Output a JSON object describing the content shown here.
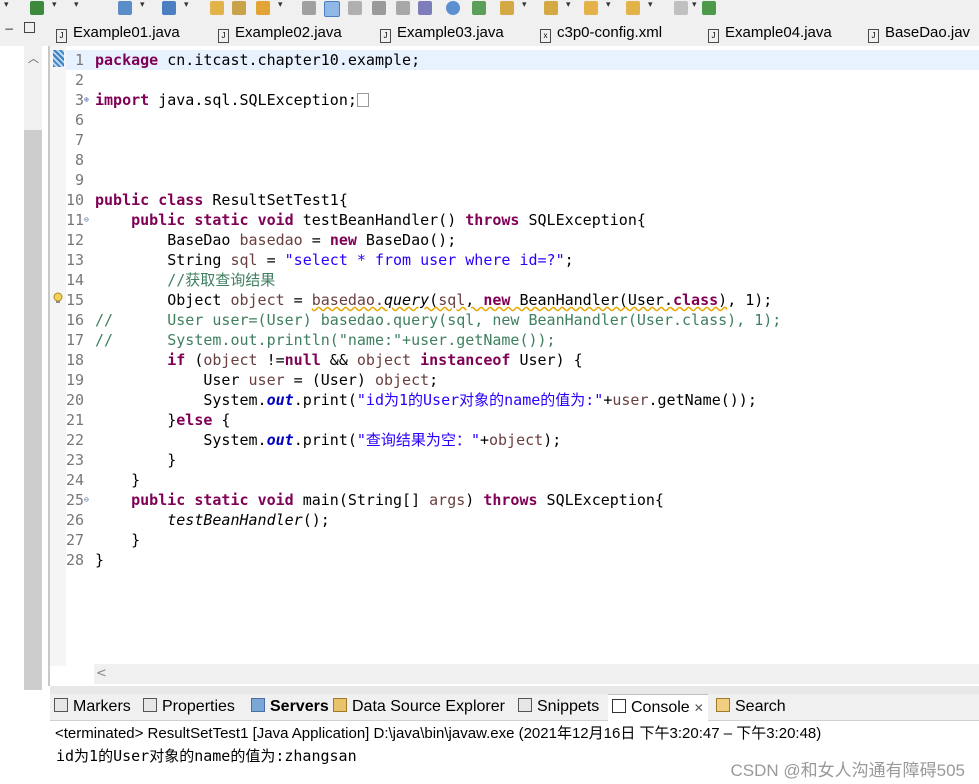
{
  "editor_tabs": [
    {
      "label": "Example01.java",
      "icon": "java-file-icon"
    },
    {
      "label": "Example02.java",
      "icon": "java-file-icon"
    },
    {
      "label": "Example03.java",
      "icon": "java-file-icon"
    },
    {
      "label": "c3p0-config.xml",
      "icon": "xml-file-icon"
    },
    {
      "label": "Example04.java",
      "icon": "java-file-icon"
    },
    {
      "label": "BaseDao.jav",
      "icon": "java-file-icon"
    }
  ],
  "code": {
    "lines": [
      {
        "n": "1",
        "fold": "",
        "tokens": [
          {
            "k": "kw",
            "t": "package"
          },
          {
            "k": "t",
            "t": " cn.itcast.chapter10.example;"
          }
        ]
      },
      {
        "n": "2",
        "fold": "",
        "tokens": []
      },
      {
        "n": "3",
        "fold": "⊕",
        "tokens": [
          {
            "k": "kw",
            "t": "import"
          },
          {
            "k": "t",
            "t": " java.sql.SQLException;"
          }
        ],
        "collapsed": true
      },
      {
        "n": "6",
        "fold": "",
        "tokens": []
      },
      {
        "n": "7",
        "fold": "",
        "tokens": []
      },
      {
        "n": "8",
        "fold": "",
        "tokens": []
      },
      {
        "n": "9",
        "fold": "",
        "tokens": []
      },
      {
        "n": "10",
        "fold": "",
        "tokens": [
          {
            "k": "kw",
            "t": "public"
          },
          {
            "k": "t",
            "t": " "
          },
          {
            "k": "kw",
            "t": "class"
          },
          {
            "k": "t",
            "t": " ResultSetTest1{"
          }
        ]
      },
      {
        "n": "11",
        "fold": "⊖",
        "tokens": [
          {
            "k": "t",
            "t": "    "
          },
          {
            "k": "kw",
            "t": "public"
          },
          {
            "k": "t",
            "t": " "
          },
          {
            "k": "kw",
            "t": "static"
          },
          {
            "k": "t",
            "t": " "
          },
          {
            "k": "kw",
            "t": "void"
          },
          {
            "k": "t",
            "t": " testBeanHandler() "
          },
          {
            "k": "kw",
            "t": "throws"
          },
          {
            "k": "t",
            "t": " SQLException{"
          }
        ]
      },
      {
        "n": "12",
        "fold": "",
        "tokens": [
          {
            "k": "t",
            "t": "        BaseDao "
          },
          {
            "k": "var",
            "t": "basedao"
          },
          {
            "k": "t",
            "t": " = "
          },
          {
            "k": "kw",
            "t": "new"
          },
          {
            "k": "t",
            "t": " BaseDao();"
          }
        ]
      },
      {
        "n": "13",
        "fold": "",
        "tokens": [
          {
            "k": "t",
            "t": "        String "
          },
          {
            "k": "var",
            "t": "sql"
          },
          {
            "k": "t",
            "t": " = "
          },
          {
            "k": "str",
            "t": "\"select * from user where id=?\""
          },
          {
            "k": "t",
            "t": ";"
          }
        ]
      },
      {
        "n": "14",
        "fold": "",
        "tokens": [
          {
            "k": "t",
            "t": "        "
          },
          {
            "k": "cm",
            "t": "//获取查询结果"
          }
        ]
      },
      {
        "n": "15",
        "fold": "",
        "tokens": [
          {
            "k": "t",
            "t": "        Object "
          },
          {
            "k": "var",
            "t": "object"
          },
          {
            "k": "t",
            "t": " = "
          },
          {
            "k": "varw",
            "t": "basedao."
          },
          {
            "k": "italw",
            "t": "query"
          },
          {
            "k": "w",
            "t": "("
          },
          {
            "k": "varw",
            "t": "sql"
          },
          {
            "k": "w",
            "t": ", "
          },
          {
            "k": "kww",
            "t": "new"
          },
          {
            "k": "w",
            "t": " BeanHandler(User."
          },
          {
            "k": "kww",
            "t": "class"
          },
          {
            "k": "w",
            "t": ")"
          },
          {
            "k": "t",
            "t": ", 1);"
          }
        ]
      },
      {
        "n": "16",
        "fold": "",
        "tokens": [
          {
            "k": "cm",
            "t": "//      User user=(User) basedao.query(sql, new BeanHandler(User.class), 1);"
          }
        ]
      },
      {
        "n": "17",
        "fold": "",
        "tokens": [
          {
            "k": "cm",
            "t": "//      System.out.println(\"name:\"+user.getName());"
          }
        ]
      },
      {
        "n": "18",
        "fold": "",
        "tokens": [
          {
            "k": "t",
            "t": "        "
          },
          {
            "k": "kw",
            "t": "if"
          },
          {
            "k": "t",
            "t": " ("
          },
          {
            "k": "var",
            "t": "object"
          },
          {
            "k": "t",
            "t": " !="
          },
          {
            "k": "kw",
            "t": "null"
          },
          {
            "k": "t",
            "t": " && "
          },
          {
            "k": "var",
            "t": "object"
          },
          {
            "k": "t",
            "t": " "
          },
          {
            "k": "kw",
            "t": "instanceof"
          },
          {
            "k": "t",
            "t": " User) {"
          }
        ]
      },
      {
        "n": "19",
        "fold": "",
        "tokens": [
          {
            "k": "t",
            "t": "            User "
          },
          {
            "k": "var",
            "t": "user"
          },
          {
            "k": "t",
            "t": " = (User) "
          },
          {
            "k": "var",
            "t": "object"
          },
          {
            "k": "t",
            "t": ";"
          }
        ]
      },
      {
        "n": "20",
        "fold": "",
        "tokens": [
          {
            "k": "t",
            "t": "            System."
          },
          {
            "k": "fld",
            "t": "out"
          },
          {
            "k": "t",
            "t": ".print("
          },
          {
            "k": "str",
            "t": "\"id为1的User对象的name的值为:\""
          },
          {
            "k": "t",
            "t": "+"
          },
          {
            "k": "var",
            "t": "user"
          },
          {
            "k": "t",
            "t": ".getName());"
          }
        ]
      },
      {
        "n": "21",
        "fold": "",
        "tokens": [
          {
            "k": "t",
            "t": "        }"
          },
          {
            "k": "kw",
            "t": "else"
          },
          {
            "k": "t",
            "t": " {"
          }
        ]
      },
      {
        "n": "22",
        "fold": "",
        "tokens": [
          {
            "k": "t",
            "t": "            System."
          },
          {
            "k": "fld",
            "t": "out"
          },
          {
            "k": "t",
            "t": ".print("
          },
          {
            "k": "str",
            "t": "\"查询结果为空：\""
          },
          {
            "k": "t",
            "t": "+"
          },
          {
            "k": "var",
            "t": "object"
          },
          {
            "k": "t",
            "t": ");"
          }
        ]
      },
      {
        "n": "23",
        "fold": "",
        "tokens": [
          {
            "k": "t",
            "t": "        }"
          }
        ]
      },
      {
        "n": "24",
        "fold": "",
        "tokens": [
          {
            "k": "t",
            "t": "    }"
          }
        ]
      },
      {
        "n": "25",
        "fold": "⊖",
        "tokens": [
          {
            "k": "t",
            "t": "    "
          },
          {
            "k": "kw",
            "t": "public"
          },
          {
            "k": "t",
            "t": " "
          },
          {
            "k": "kw",
            "t": "static"
          },
          {
            "k": "t",
            "t": " "
          },
          {
            "k": "kw",
            "t": "void"
          },
          {
            "k": "t",
            "t": " main(String[] "
          },
          {
            "k": "var",
            "t": "args"
          },
          {
            "k": "t",
            "t": ") "
          },
          {
            "k": "kw",
            "t": "throws"
          },
          {
            "k": "t",
            "t": " SQLException{"
          }
        ]
      },
      {
        "n": "26",
        "fold": "",
        "tokens": [
          {
            "k": "t",
            "t": "        "
          },
          {
            "k": "ital",
            "t": "testBeanHandler"
          },
          {
            "k": "t",
            "t": "();"
          }
        ]
      },
      {
        "n": "27",
        "fold": "",
        "tokens": [
          {
            "k": "t",
            "t": "    }"
          }
        ]
      },
      {
        "n": "28",
        "fold": "",
        "tokens": [
          {
            "k": "t",
            "t": "}"
          }
        ]
      }
    ]
  },
  "bottom_tabs": [
    {
      "label": "Markers",
      "icon": "markers-icon",
      "active": false,
      "bold": false
    },
    {
      "label": "Properties",
      "icon": "properties-icon",
      "active": false,
      "bold": false
    },
    {
      "label": "Servers",
      "icon": "servers-icon",
      "active": false,
      "bold": true
    },
    {
      "label": "Data Source Explorer",
      "icon": "data-source-icon",
      "active": false,
      "bold": false
    },
    {
      "label": "Snippets",
      "icon": "snippets-icon",
      "active": false,
      "bold": false
    },
    {
      "label": "Console",
      "icon": "console-icon",
      "active": true,
      "bold": false
    },
    {
      "label": "Search",
      "icon": "search-icon",
      "active": false,
      "bold": false
    }
  ],
  "console": {
    "status": "<terminated> ResultSetTest1 [Java Application] D:\\java\\bin\\javaw.exe  (2021年12月16日 下午3:20:47 – 下午3:20:48)",
    "output": "id为1的User对象的name的值为:zhangsan"
  },
  "watermark": "CSDN @和女人沟通有障碍505",
  "colors": {
    "keyword": "#7f0055",
    "string": "#2a00ff",
    "comment": "#3f7f5f",
    "field": "#0000c0",
    "local_var": "#6a3e3e",
    "line_number": "#787878",
    "current_line": "#e8f2fe"
  }
}
